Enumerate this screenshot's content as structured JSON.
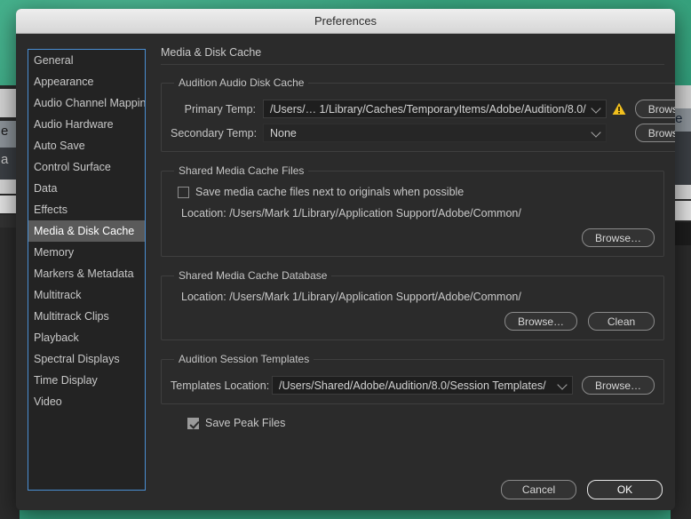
{
  "window": {
    "title": "Preferences"
  },
  "sidebar": {
    "items": [
      {
        "label": "General",
        "selected": false
      },
      {
        "label": "Appearance",
        "selected": false
      },
      {
        "label": "Audio Channel Mapping",
        "selected": false
      },
      {
        "label": "Audio Hardware",
        "selected": false
      },
      {
        "label": "Auto Save",
        "selected": false
      },
      {
        "label": "Control Surface",
        "selected": false
      },
      {
        "label": "Data",
        "selected": false
      },
      {
        "label": "Effects",
        "selected": false
      },
      {
        "label": "Media & Disk Cache",
        "selected": true
      },
      {
        "label": "Memory",
        "selected": false
      },
      {
        "label": "Markers & Metadata",
        "selected": false
      },
      {
        "label": "Multitrack",
        "selected": false
      },
      {
        "label": "Multitrack Clips",
        "selected": false
      },
      {
        "label": "Playback",
        "selected": false
      },
      {
        "label": "Spectral Displays",
        "selected": false
      },
      {
        "label": "Time Display",
        "selected": false
      },
      {
        "label": "Video",
        "selected": false
      }
    ]
  },
  "main": {
    "title": "Media & Disk Cache",
    "audio_disk_cache": {
      "legend": "Audition Audio Disk Cache",
      "primary_label": "Primary Temp:",
      "primary_value": "/Users/… 1/Library/Caches/TemporaryItems/Adobe/Audition/8.0/",
      "primary_warning": true,
      "primary_browse": "Browse…",
      "secondary_label": "Secondary Temp:",
      "secondary_value": "None",
      "secondary_browse": "Browse…"
    },
    "cache_files": {
      "legend": "Shared Media Cache Files",
      "checkbox_label": "Save media cache files next to originals when possible",
      "checkbox_checked": false,
      "location": "Location: /Users/Mark 1/Library/Application Support/Adobe/Common/",
      "browse": "Browse…"
    },
    "cache_database": {
      "legend": "Shared Media Cache Database",
      "location": "Location: /Users/Mark 1/Library/Application Support/Adobe/Common/",
      "browse": "Browse…",
      "clean": "Clean"
    },
    "session_templates": {
      "legend": "Audition Session Templates",
      "label": "Templates Location:",
      "value": "/Users/Shared/Adobe/Audition/8.0/Session Templates/",
      "browse": "Browse…"
    },
    "save_peak": {
      "label": "Save Peak Files",
      "checked": true
    }
  },
  "footer": {
    "cancel": "Cancel",
    "ok": "OK"
  },
  "colors": {
    "accent_focus": "#4a8fd4",
    "warning": "#f2c01e",
    "dialog_bg": "#2b2b2b",
    "titlebar": "#e4e4e4",
    "selection": "#5a5a5a",
    "desktop": "#2f9a79"
  },
  "background_app": {
    "left_fragments": [
      "e",
      "a"
    ],
    "right_fragment": "te"
  }
}
